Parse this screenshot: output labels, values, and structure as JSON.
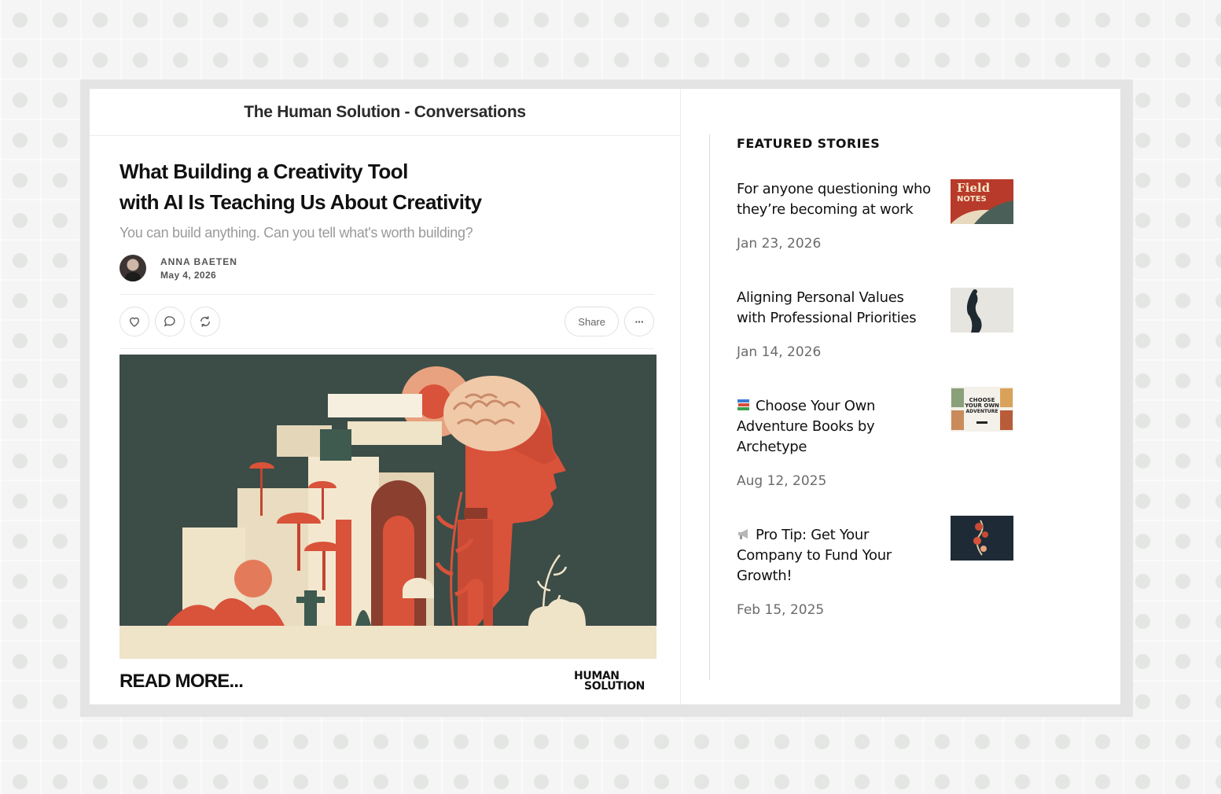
{
  "publication": {
    "title": "The Human Solution - Conversations"
  },
  "post": {
    "title_line1": "What Building a Creativity Tool",
    "title_line2": "with AI Is Teaching Us About Creativity",
    "subtitle": "You can build anything. Can you tell what's worth building?",
    "author": "ANNA BAETEN",
    "date": "May 4, 2026",
    "share_label": "Share",
    "more_label": "···",
    "read_more": "READ MORE...",
    "logo_line1": "HUMAN",
    "logo_line2": "SOLUTION"
  },
  "featured": {
    "heading": "FEATURED STORIES",
    "stories": [
      {
        "title": "For anyone questioning who they’re becoming at work",
        "date": "Jan 23, 2026",
        "thumb_text_1": "Field",
        "thumb_text_2": "NOTES"
      },
      {
        "title": "Aligning Personal Values with Professional Priorities",
        "date": "Jan 14, 2026"
      },
      {
        "emoji": "books-emoji",
        "title": "Choose Your Own Adventure Books by Archetype",
        "date": "Aug 12, 2025",
        "thumb_text_1": "CHOOSE",
        "thumb_text_2": "YOUR OWN",
        "thumb_text_3": "ADVENTURE"
      },
      {
        "emoji": "megaphone-emoji",
        "title": "Pro Tip: Get Your Company to Fund Your Growth!",
        "date": "Feb 15, 2025"
      }
    ]
  },
  "colors": {
    "hero_bg": "#3c4c47",
    "accent_red": "#d9523a",
    "cream": "#efe3c8"
  }
}
